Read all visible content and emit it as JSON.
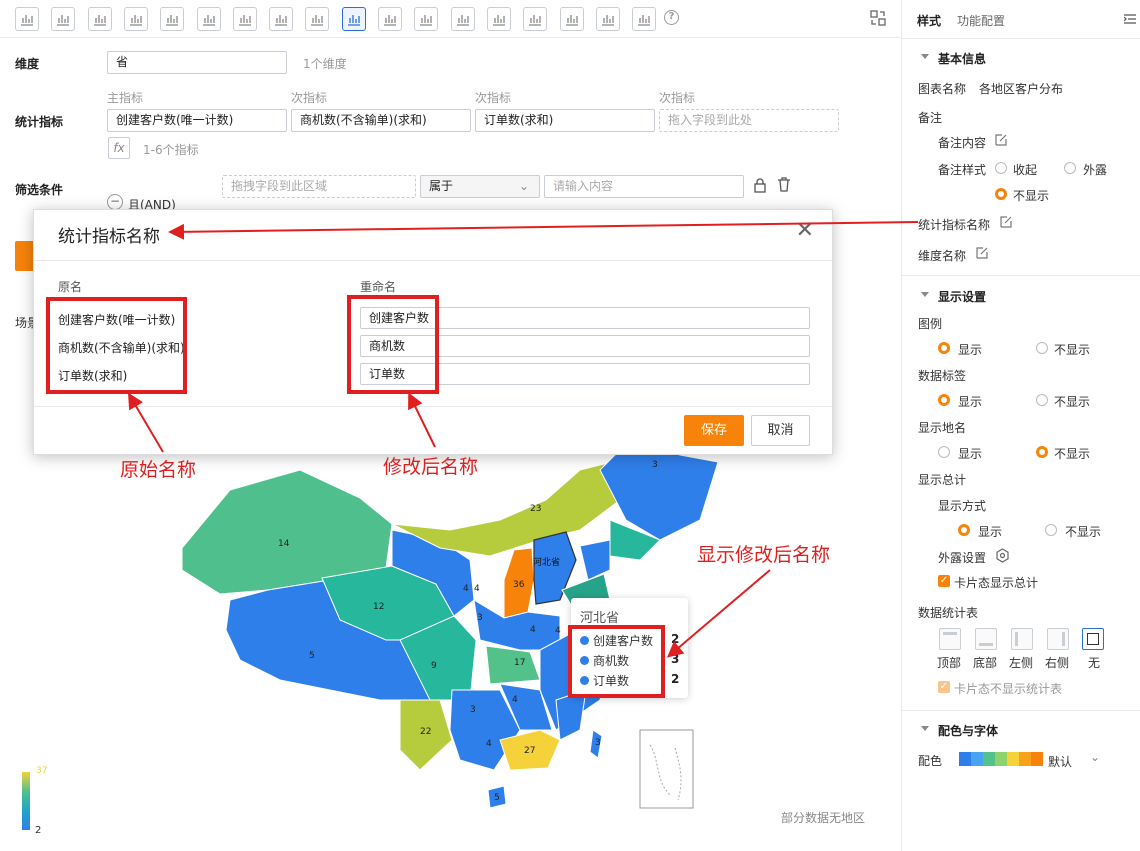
{
  "toolbar": {
    "icons": [
      "bar-chart-icon",
      "line-chart-icon",
      "pie-chart-icon",
      "funnel-icon",
      "funnel-alt-icon",
      "table-icon",
      "combo-chart-icon",
      "card-icon",
      "gauge-icon",
      "map-icon",
      "bubble-map-icon",
      "heat-map-icon",
      "flow-map-icon",
      "column-icon",
      "area-icon",
      "matrix-icon",
      "pivot-icon",
      "scatter-icon"
    ],
    "active_icon": "map-icon",
    "help": "?"
  },
  "config": {
    "dimension_label": "维度",
    "dimension_value": "省",
    "dimension_hint": "1个维度",
    "metrics_label": "统计指标",
    "metric_main_label": "主指标",
    "metric_sub_label": "次指标",
    "metrics": [
      "创建客户数(唯一计数)",
      "商机数(不含输单)(求和)",
      "订单数(求和)"
    ],
    "metric_placeholder": "拖入字段到此处",
    "fx": "fx",
    "metrics_hint": "1-6个指标",
    "filter_label": "筛选条件",
    "filter_logic": "且(AND)",
    "filter_field_placeholder": "拖拽字段到此区域",
    "filter_operator": "属于",
    "filter_value_placeholder": "请输入内容",
    "scene_label": "场景"
  },
  "modal": {
    "title": "统计指标名称",
    "col_original": "原名",
    "col_rename": "重命名",
    "originals": [
      "创建客户数(唯一计数)",
      "商机数(不含输单)(求和)",
      "订单数(求和)"
    ],
    "renames": [
      "创建客户数",
      "商机数",
      "订单数"
    ],
    "save": "保存",
    "cancel": "取消"
  },
  "map": {
    "region_values": [
      "14",
      "12",
      "5",
      "9",
      "22",
      "4",
      "3",
      "4",
      "4",
      "36",
      "23",
      "3",
      "4",
      "17",
      "3",
      "4",
      "4",
      "27",
      "3",
      "5"
    ],
    "no_region_note": "部分数据无地区",
    "legend_min": "2",
    "legend_max": "37",
    "colors": {
      "low": "#2f7fea",
      "mid": "#52c28a",
      "high": "#f5d13a",
      "max": "#f7830b"
    }
  },
  "tooltip": {
    "title": "河北省",
    "rows": [
      {
        "label": "创建客户数",
        "value": "2"
      },
      {
        "label": "商机数",
        "value": "3"
      },
      {
        "label": "订单数",
        "value": "2"
      }
    ]
  },
  "annotations": {
    "original": "原始名称",
    "renamed": "修改后名称",
    "display": "显示修改后名称"
  },
  "panel": {
    "tab_style": "样式",
    "tab_function": "功能配置",
    "basic_info": "基本信息",
    "chart_name_label": "图表名称",
    "chart_name": "各地区客户分布",
    "note_label": "备注",
    "note_content": "备注内容",
    "note_style": "备注样式",
    "note_opt_collapse": "收起",
    "note_opt_expose": "外露",
    "note_opt_hide": "不显示",
    "metric_name": "统计指标名称",
    "dimension_name": "维度名称",
    "display_settings": "显示设置",
    "legend": "图例",
    "data_label": "数据标签",
    "show_region_name": "显示地名",
    "show_total": "显示总计",
    "display_mode": "显示方式",
    "expose_settings": "外露设置",
    "card_total": "卡片态显示总计",
    "data_table": "数据统计表",
    "positions": [
      "顶部",
      "底部",
      "左侧",
      "右侧",
      "无"
    ],
    "card_no_table": "卡片态不显示统计表",
    "show": "显示",
    "hide": "不显示",
    "color_font": "配色与字体",
    "color_label": "配色",
    "color_default": "默认",
    "palette": [
      "#2f7fea",
      "#4aa3f0",
      "#52c28a",
      "#8fd16a",
      "#f5d13a",
      "#f7a21b",
      "#f7830b"
    ],
    "accent": "#f7830b"
  }
}
